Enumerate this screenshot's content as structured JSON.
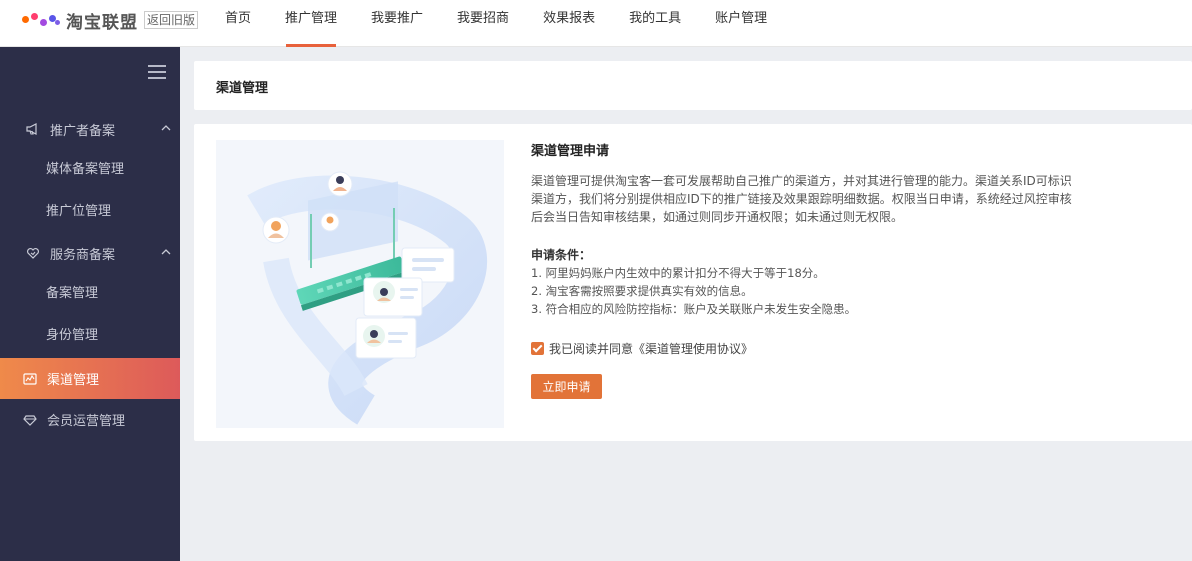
{
  "brand": {
    "logo_text": "淘宝联盟",
    "old_version_label": "返回旧版",
    "logo_colors": [
      "#ff6a00",
      "#ff3d6e",
      "#a34ae0",
      "#5a55e8"
    ]
  },
  "nav": {
    "items": [
      {
        "label": "首页",
        "active": false
      },
      {
        "label": "推广管理",
        "active": true
      },
      {
        "label": "我要推广",
        "active": false
      },
      {
        "label": "我要招商",
        "active": false
      },
      {
        "label": "效果报表",
        "active": false
      },
      {
        "label": "我的工具",
        "active": false
      },
      {
        "label": "账户管理",
        "active": false
      }
    ],
    "accent_color": "#e8613b"
  },
  "sidebar": {
    "groups": [
      {
        "label": "推广者备案",
        "icon": "megaphone-icon",
        "expanded": true,
        "children": [
          "媒体备案管理",
          "推广位管理"
        ]
      },
      {
        "label": "服务商备案",
        "icon": "handshake-icon",
        "expanded": true,
        "children": [
          "备案管理",
          "身份管理"
        ]
      }
    ],
    "items": [
      {
        "label": "渠道管理",
        "icon": "channel-icon",
        "active": true
      },
      {
        "label": "会员运营管理",
        "icon": "diamond-icon",
        "active": false
      }
    ]
  },
  "page_title": "渠道管理",
  "main": {
    "heading": "渠道管理申请",
    "description": "渠道管理可提供淘宝客一套可发展帮助自己推广的渠道方，并对其进行管理的能力。渠道关系ID可标识渠道方，我们将分别提供相应ID下的推广链接及效果跟踪明细数据。权限当日申请，系统经过风控审核后会当日告知审核结果，如通过则同步开通权限；如未通过则无权限。",
    "conditions_title": "申请条件：",
    "conditions": [
      "1. 阿里妈妈账户内生效中的累计扣分不得大于等于18分。",
      "2. 淘宝客需按照要求提供真实有效的信息。",
      "3. 符合相应的风险防控指标：账户及关联账户未发生安全隐患。"
    ],
    "agreement_checked": true,
    "agreement_text": "我已阅读并同意《渠道管理使用协议》",
    "apply_button": "立即申请",
    "button_color": "#e27338"
  }
}
